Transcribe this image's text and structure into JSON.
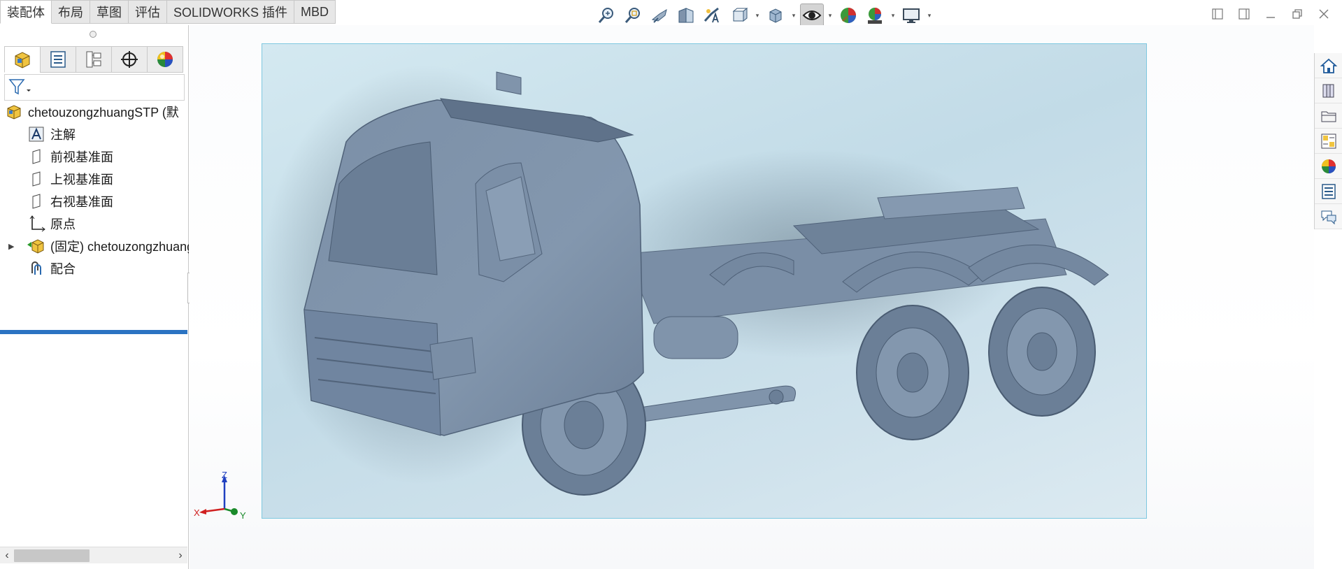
{
  "command_tabs": [
    {
      "label": "装配体",
      "active": true
    },
    {
      "label": "布局",
      "active": false
    },
    {
      "label": "草图",
      "active": false
    },
    {
      "label": "评估",
      "active": false
    },
    {
      "label": "SOLIDWORKS 插件",
      "active": false
    },
    {
      "label": "MBD",
      "active": false
    }
  ],
  "heads_up_toolbar": [
    "zoom-to-fit-icon",
    "zoom-to-area-icon",
    "previous-view-icon",
    "section-view-icon",
    "dynamic-annotation-view-icon",
    "view-orientation-icon",
    "display-style-icon",
    "hide-show-items-icon",
    "edit-appearance-icon",
    "apply-scene-icon",
    "view-settings-icon"
  ],
  "feature_tree": {
    "root": "chetouzongzhuangSTP  (默",
    "items": [
      {
        "label": "注解",
        "icon": "annotations-icon"
      },
      {
        "label": "前视基准面",
        "icon": "plane-icon"
      },
      {
        "label": "上视基准面",
        "icon": "plane-icon"
      },
      {
        "label": "右视基准面",
        "icon": "plane-icon"
      },
      {
        "label": "原点",
        "icon": "origin-icon"
      },
      {
        "label": "(固定) chetouzongzhuangSTP",
        "icon": "part-icon"
      },
      {
        "label": "配合",
        "icon": "mates-icon"
      }
    ]
  },
  "triad": {
    "x": "X",
    "y": "Y",
    "z": "Z"
  },
  "colors": {
    "accent": "#2b73c2",
    "model": "#7f93ab",
    "selection": "#7ec8e0"
  }
}
